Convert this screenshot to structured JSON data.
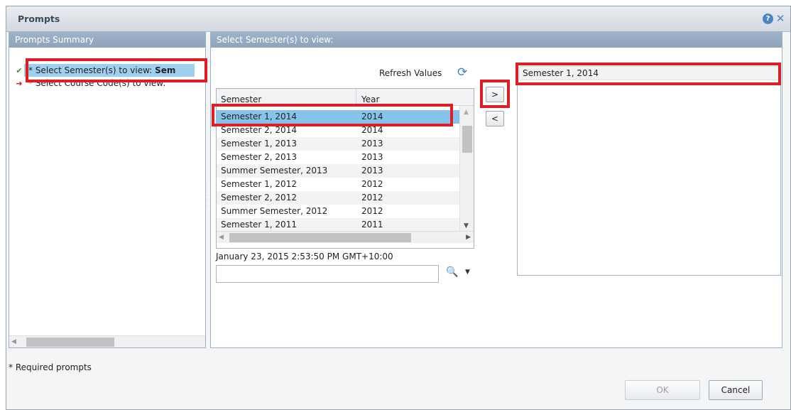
{
  "dialog": {
    "title": "Prompts",
    "help_icon": "help-icon",
    "close_icon": "close-icon"
  },
  "summary": {
    "header": "Prompts Summary",
    "items": [
      {
        "status_icon": "check-icon",
        "label_prefix": "* Select Semester(s) to view: ",
        "label_value": "Sem"
      },
      {
        "status_icon": "red-arrow-icon",
        "label_prefix": "* Select Course Code(s) to view:",
        "label_value": ""
      }
    ]
  },
  "main": {
    "header": "Select Semester(s) to view:",
    "refresh_label": "Refresh Values",
    "columns": [
      "Semester",
      "Year"
    ],
    "rows": [
      {
        "semester": "Semester 1, 2014",
        "year": "2014"
      },
      {
        "semester": "Semester 2, 2014",
        "year": "2014"
      },
      {
        "semester": "Semester 1, 2013",
        "year": "2013"
      },
      {
        "semester": "Semester 2, 2013",
        "year": "2013"
      },
      {
        "semester": "Summer Semester, 2013",
        "year": "2013"
      },
      {
        "semester": "Semester 1, 2012",
        "year": "2012"
      },
      {
        "semester": "Semester 2, 2012",
        "year": "2012"
      },
      {
        "semester": "Summer Semester, 2012",
        "year": "2012"
      },
      {
        "semester": "Semester 1, 2011",
        "year": "2011"
      }
    ],
    "refresh_timestamp": "January 23, 2015 2:53:50 PM GMT+10:00",
    "search_value": "",
    "add_label": ">",
    "remove_label": "<",
    "selected_values": [
      "Semester 1, 2014"
    ]
  },
  "footer": {
    "required_note": "* Required prompts",
    "ok_label": "OK",
    "cancel_label": "Cancel"
  },
  "colors": {
    "highlight_box": "#e01c24",
    "selection": "#86c3ea",
    "panel_header": "#9fb3c8"
  }
}
